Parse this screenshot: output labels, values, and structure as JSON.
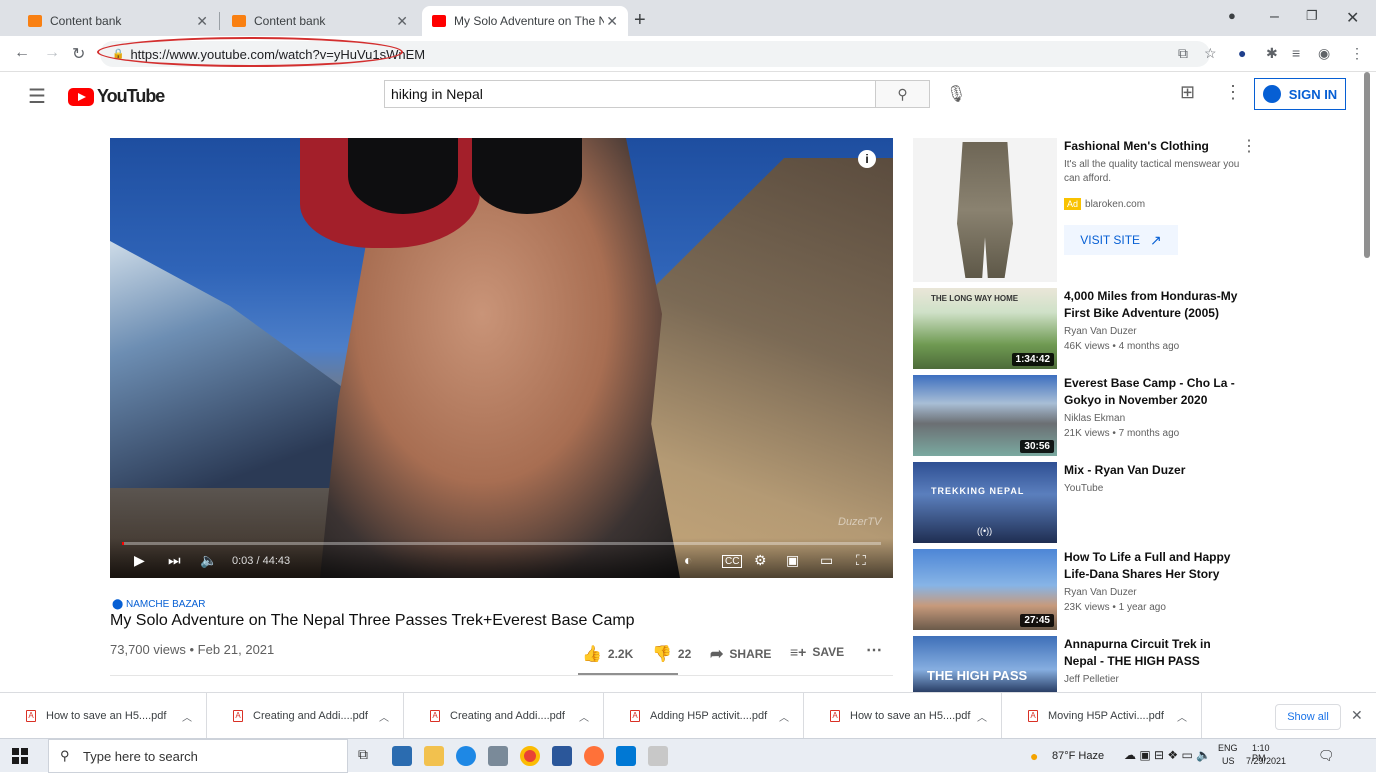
{
  "browser": {
    "tabs": [
      {
        "label": "Content bank",
        "active": false
      },
      {
        "label": "Content bank",
        "active": false
      },
      {
        "label": "My Solo Adventure on The Nepa",
        "active": true
      }
    ],
    "url": "https://www.youtube.com/watch?v=yHuVu1sWnEM"
  },
  "youtube": {
    "logo_text": "YouTube",
    "search_value": "hiking in Nepal",
    "signin_label": "SIGN IN"
  },
  "player": {
    "time": "0:03 / 44:43",
    "progress_fraction": 0.001,
    "watermark": "DuzerTV"
  },
  "video": {
    "location": "NAMCHE BAZAR",
    "title": "My Solo Adventure on The Nepal Three Passes Trek+Everest Base Camp",
    "meta": "73,700 views • Feb 21, 2021",
    "likes": "2.2K",
    "dislikes": "22",
    "share_label": "SHARE",
    "save_label": "SAVE"
  },
  "ad": {
    "title": "Fashional Men's Clothing",
    "desc": "It's all the quality tactical menswear you can afford.",
    "badge": "Ad",
    "domain": "blaroken.com",
    "cta": "VISIT SITE"
  },
  "related": [
    {
      "title": "4,000 Miles from Honduras-My First Bike Adventure (2005)",
      "channel": "Ryan Van Duzer",
      "meta": "46K views • 4 months ago",
      "duration": "1:34:42",
      "thumb_text": "THE LONG WAY HOME"
    },
    {
      "title": "Everest Base Camp - Cho La - Gokyo in November 2020",
      "channel": "Niklas Ekman",
      "meta": "21K views • 7 months ago",
      "duration": "30:56",
      "thumb_text": ""
    },
    {
      "title": "Mix - Ryan Van Duzer",
      "channel": "YouTube",
      "meta": "",
      "duration": "",
      "thumb_text": "TREKKING NEPAL"
    },
    {
      "title": "How To Life a Full and Happy Life-Dana Shares Her Story",
      "channel": "Ryan Van Duzer",
      "meta": "23K views • 1 year ago",
      "duration": "27:45",
      "thumb_text": ""
    },
    {
      "title": "Annapurna Circuit Trek in Nepal - THE HIGH PASS",
      "channel": "Jeff Pelletier",
      "meta": "",
      "duration": "",
      "thumb_text": "THE HIGH PASS"
    }
  ],
  "downloads": {
    "items": [
      "How to save an H5....pdf",
      "Creating and Addi....pdf",
      "Creating and Addi....pdf",
      "Adding H5P activit....pdf",
      "How to save an H5....pdf",
      "Moving H5P Activi....pdf"
    ],
    "show_all": "Show all"
  },
  "taskbar": {
    "search_placeholder": "Type here to search",
    "weather": "87°F Haze",
    "lang": "ENG",
    "region": "US",
    "time": "1:10 PM",
    "date": "7/29/2021"
  },
  "colors": {
    "yt_red": "#ff0000",
    "yt_blue": "#065fd4",
    "url_highlight": "#d32f2f"
  }
}
